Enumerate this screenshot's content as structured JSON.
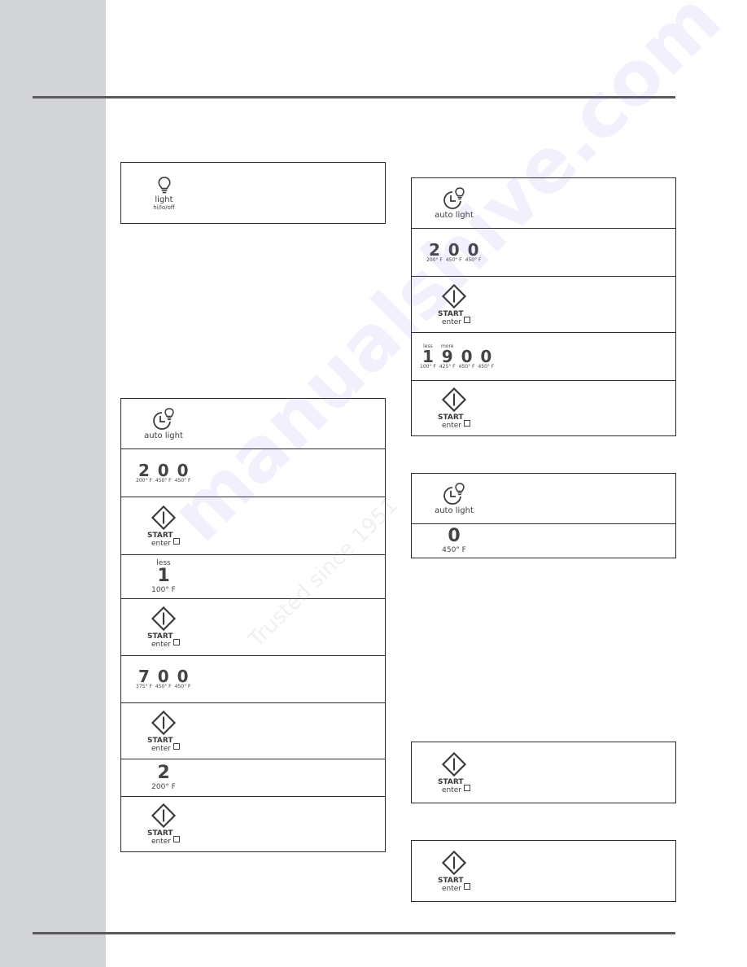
{
  "page": {
    "colors": {
      "sidebar": "#d3d4d6",
      "rule": "#5a5a5c",
      "ink": "#3a3a3a",
      "watermark": "#786ee6"
    }
  },
  "watermark": {
    "brand": "manualshive.com",
    "tagline": "Trusted since 1951"
  },
  "light_panel": {
    "label": "light",
    "sub": "hi/lo/off",
    "icon": "light-bulb-icon"
  },
  "left_sequence": {
    "auto_light": {
      "label": "auto light",
      "icon": "clock-light-icon"
    },
    "code_200": {
      "digits": [
        {
          "d": "2",
          "t": "200° F"
        },
        {
          "d": "0",
          "t": "450° F"
        },
        {
          "d": "0",
          "t": "450° F"
        }
      ]
    },
    "start1": {
      "s": "START",
      "e": "enter"
    },
    "less_1": {
      "tag": "less",
      "d": "1",
      "t": "100° F"
    },
    "start2": {
      "s": "START",
      "e": "enter"
    },
    "code_700": {
      "digits": [
        {
          "d": "7",
          "t": "375° F"
        },
        {
          "d": "0",
          "t": "450° F"
        },
        {
          "d": "0",
          "t": "450° F"
        }
      ]
    },
    "start3": {
      "s": "START",
      "e": "enter"
    },
    "key_2": {
      "d": "2",
      "t": "200° F"
    },
    "start4": {
      "s": "START",
      "e": "enter"
    }
  },
  "right_sequence": {
    "auto_light": {
      "label": "auto light",
      "icon": "clock-light-icon"
    },
    "code_200": {
      "digits": [
        {
          "d": "2",
          "t": "200° F"
        },
        {
          "d": "0",
          "t": "450° F"
        },
        {
          "d": "0",
          "t": "450° F"
        }
      ]
    },
    "start1": {
      "s": "START",
      "e": "enter"
    },
    "code_1900": {
      "digits": [
        {
          "tag": "less",
          "d": "1",
          "t": "100° F"
        },
        {
          "tag": "more",
          "d": "9",
          "t": "425° F"
        },
        {
          "tag": "",
          "d": "0",
          "t": "450° F"
        },
        {
          "tag": "",
          "d": "0",
          "t": "450° F"
        }
      ]
    },
    "start2": {
      "s": "START",
      "e": "enter"
    }
  },
  "right_cancel": {
    "auto_light": {
      "label": "auto light",
      "icon": "clock-light-icon"
    },
    "key_0": {
      "d": "0",
      "t": "450° F"
    }
  },
  "right_start_a": {
    "s": "START",
    "e": "enter"
  },
  "right_start_b": {
    "s": "START",
    "e": "enter"
  }
}
